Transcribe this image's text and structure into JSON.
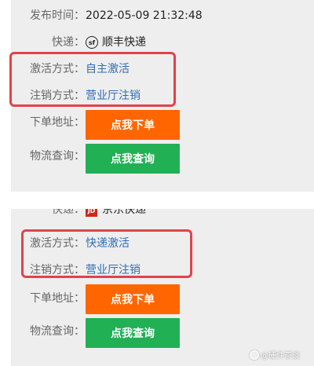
{
  "card1": {
    "publish_time_label": "发布时间：",
    "publish_time_value": "2022-05-09 21:32:48",
    "courier_label": "快递：",
    "courier_logo": "sf",
    "courier_value": "顺丰快递",
    "activation_label": "激活方式：",
    "activation_value": "自主激活",
    "cancel_label": "注销方式：",
    "cancel_value": "营业厅注销",
    "order_label": "下单地址：",
    "order_button": "点我下单",
    "track_label": "物流查询：",
    "track_button": "点我查询"
  },
  "card2": {
    "courier_label": "快递：",
    "courier_logo": "JD",
    "courier_value": "京东快递",
    "activation_label": "激活方式：",
    "activation_value": "快递激活",
    "cancel_label": "注销方式：",
    "cancel_value": "营业厅注销",
    "order_label": "下单地址：",
    "order_button": "点我下单",
    "track_label": "物流查询：",
    "track_button": "点我查询"
  },
  "watermark": "@硬件茶谈",
  "colors": {
    "order_button": "#ff6600",
    "track_button": "#22b055",
    "highlight": "#e0434a",
    "link": "#2f6fb3"
  }
}
